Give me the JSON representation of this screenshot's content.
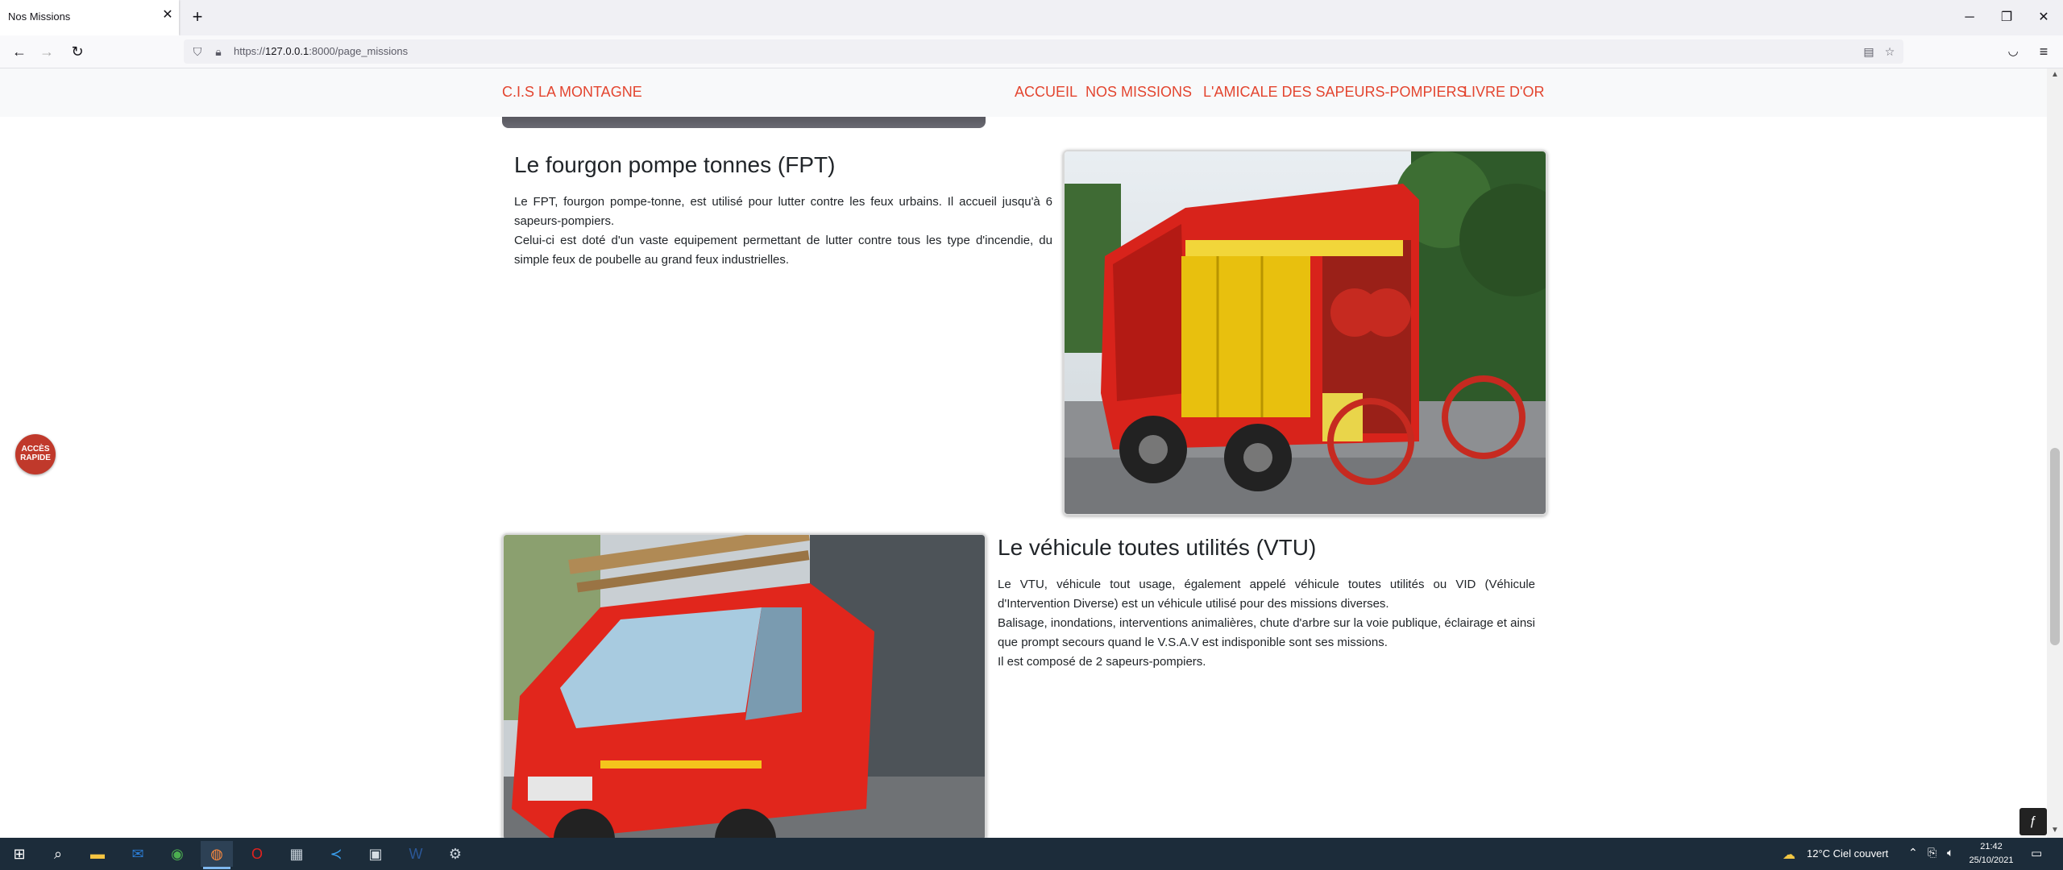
{
  "browser": {
    "tab_title": "Nos Missions",
    "tab_close": "✕",
    "new_tab": "+",
    "url_prefix": "https://",
    "url_host": "127.0.0.1",
    "url_rest": ":8000/page_missions",
    "window_controls": {
      "minimize": "─",
      "maximize": "❐",
      "close": "✕"
    }
  },
  "site": {
    "brand": "C.I.S LA MONTAGNE",
    "menu": [
      {
        "label": "ACCUEIL"
      },
      {
        "label": "NOS MISSIONS"
      },
      {
        "label": "L'AMICALE DES SAPEURS-POMPIERS"
      },
      {
        "label": "LIVRE D'OR"
      }
    ]
  },
  "sections": [
    {
      "title": "Le fourgon pompe tonnes (FPT)",
      "paragraphs": [
        "Le FPT, fourgon pompe-tonne, est utilisé pour lutter contre les feux urbains. Il accueil jusqu'à 6 sapeurs-pompiers.",
        "Celui-ci est doté d'un vaste equipement permettant de lutter contre tous les type d'incendie, du simple feux de poubelle au grand feux industrielles."
      ],
      "image_icon": "fire-truck-photo"
    },
    {
      "title": "Le véhicule toutes utilités (VTU)",
      "paragraphs": [
        "Le VTU, véhicule tout usage, également appelé véhicule toutes utilités ou VID (Véhicule d'Intervention Diverse) est un véhicule utilisé pour des missions diverses.",
        "Balisage, inondations, interventions animalières, chute d'arbre sur la voie publique, éclairage et ainsi que prompt secours quand le V.S.A.V est indisponible sont ses missions.",
        "Il est composé de 2 sapeurs-pompiers."
      ],
      "image_icon": "utility-van-photo"
    }
  ],
  "quick_access": {
    "line1": "ACCÈS",
    "line2": "RAPIDE"
  },
  "taskbar": {
    "weather": "12°C  Ciel couvert",
    "time": "21:42",
    "date": "25/10/2021"
  },
  "colors": {
    "brand_red": "#e3452f",
    "nav_bg": "#f8f9fa",
    "taskbar_bg": "#1c2c3a"
  }
}
